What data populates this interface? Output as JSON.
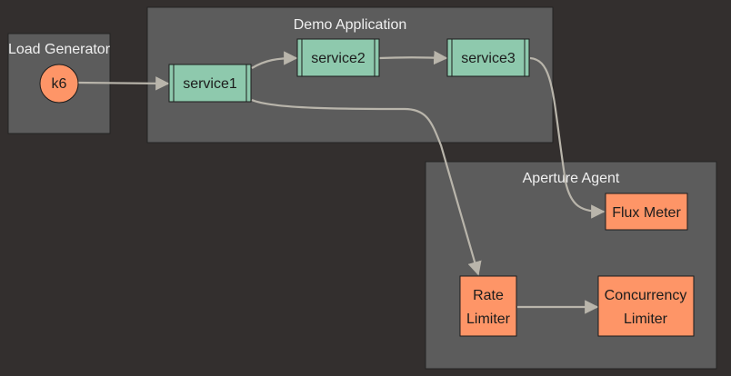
{
  "colors": {
    "background": "#332f2e",
    "cluster_fill": "#5c5c5c",
    "cluster_stroke": "#232323",
    "service_fill": "#8ec9ad",
    "component_fill": "#fe9567",
    "edge": "#b9b5ab"
  },
  "clusters": {
    "load_generator": {
      "label": "Load Generator"
    },
    "demo_application": {
      "label": "Demo Application"
    },
    "aperture_agent": {
      "label": "Aperture Agent"
    }
  },
  "nodes": {
    "k6": {
      "label": "k6"
    },
    "service1": {
      "label": "service1"
    },
    "service2": {
      "label": "service2"
    },
    "service3": {
      "label": "service3"
    },
    "flux_meter": {
      "label": "Flux Meter"
    },
    "rate_limiter": {
      "lines": [
        "Rate",
        "Limiter"
      ]
    },
    "concurrency_limiter": {
      "lines": [
        "Concurrency",
        "Limiter"
      ]
    }
  },
  "edges": [
    {
      "from": "k6",
      "to": "service1"
    },
    {
      "from": "service1",
      "to": "service2"
    },
    {
      "from": "service2",
      "to": "service3"
    },
    {
      "from": "service3",
      "to": "flux_meter"
    },
    {
      "from": "service1",
      "to": "rate_limiter"
    },
    {
      "from": "rate_limiter",
      "to": "concurrency_limiter"
    }
  ]
}
